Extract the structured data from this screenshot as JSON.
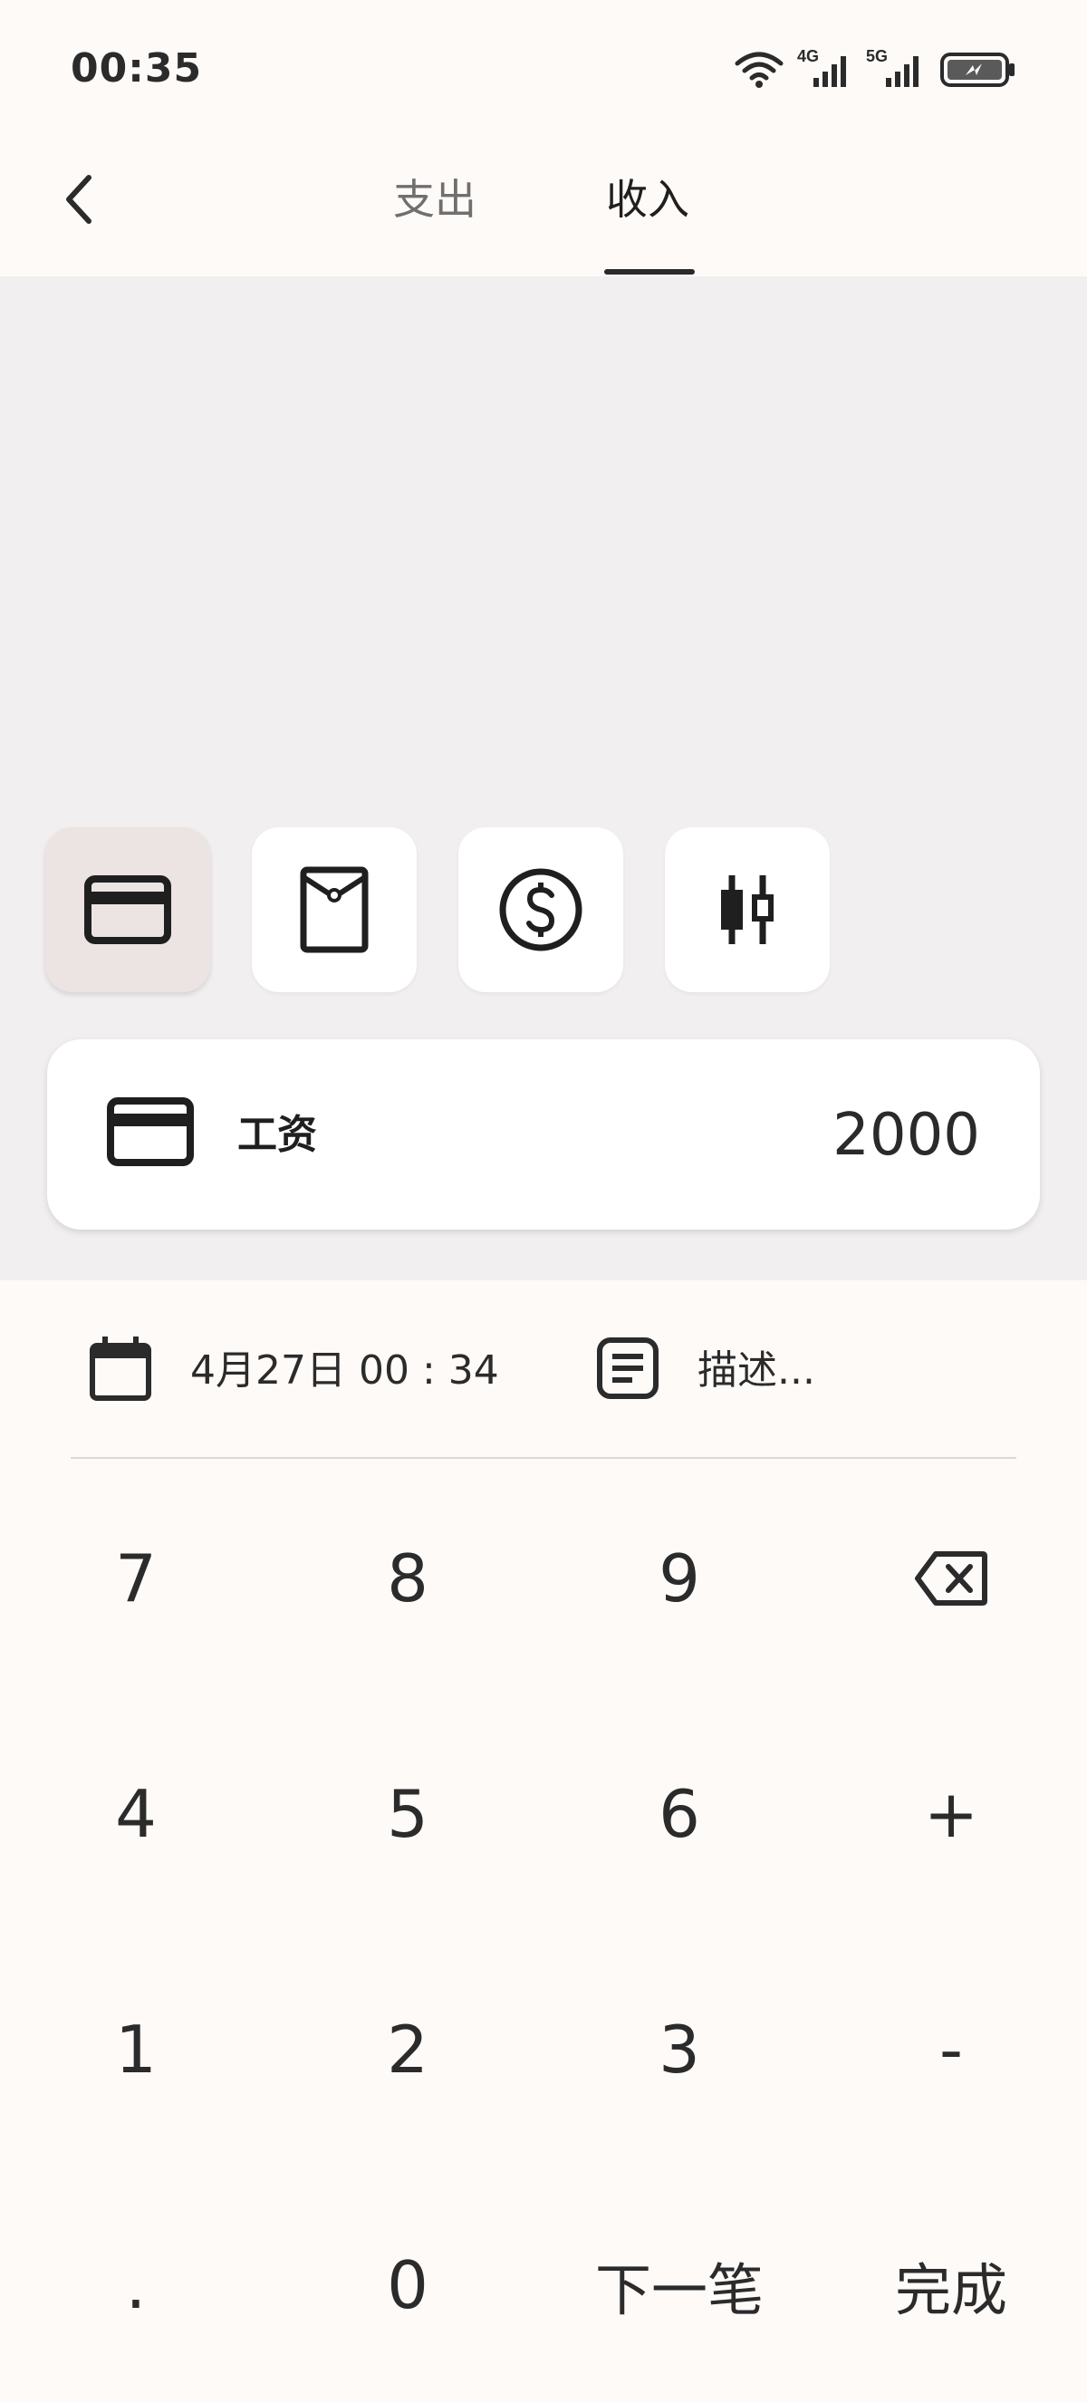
{
  "status_bar": {
    "time": "00:35",
    "icons": [
      "wifi-icon",
      "signal-4g-icon",
      "signal-5g-icon",
      "battery-charging-icon"
    ],
    "net_4g": "4G",
    "net_5g": "5G"
  },
  "header": {
    "tabs": [
      {
        "label": "支出",
        "active": false
      },
      {
        "label": "收入",
        "active": true
      }
    ]
  },
  "categories": [
    {
      "icon": "credit-card-icon",
      "selected": true
    },
    {
      "icon": "red-envelope-icon",
      "selected": false
    },
    {
      "icon": "dollar-coin-icon",
      "selected": false
    },
    {
      "icon": "candlestick-chart-icon",
      "selected": false
    }
  ],
  "entry": {
    "name": "工资",
    "amount": "2000",
    "icon": "credit-card-icon"
  },
  "meta": {
    "date": "4月27日 00 : 34",
    "description_placeholder": "描述..."
  },
  "keypad": {
    "rows": [
      [
        "7",
        "8",
        "9",
        "backspace"
      ],
      [
        "4",
        "5",
        "6",
        "+"
      ],
      [
        "1",
        "2",
        "3",
        "-"
      ],
      [
        ".",
        "0",
        "下一笔",
        "完成"
      ]
    ]
  },
  "colors": {
    "background": "#fdfaf8",
    "content_area": "#f2eff0",
    "selected_category": "#ece4e2",
    "text": "#1f1f1f"
  }
}
